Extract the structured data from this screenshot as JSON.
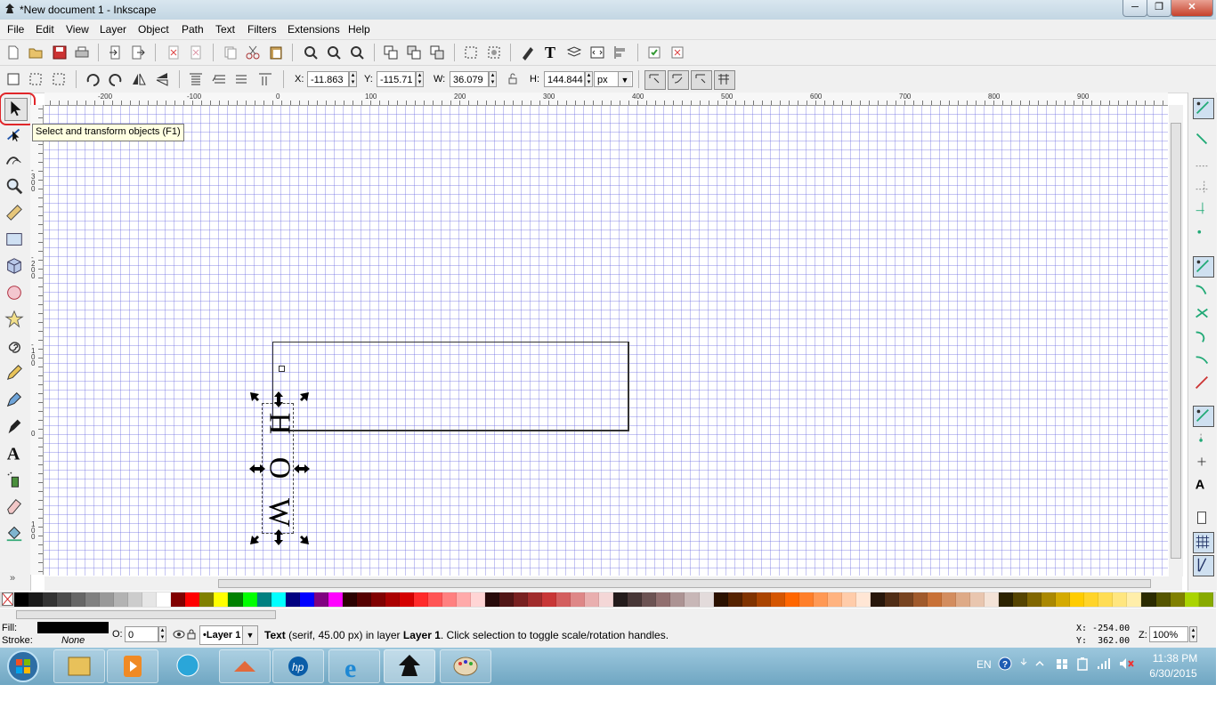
{
  "window": {
    "title": "*New document 1 - Inkscape",
    "minimize": "─",
    "maximize": "❐",
    "close": "✕"
  },
  "menu": [
    "File",
    "Edit",
    "View",
    "Layer",
    "Object",
    "Path",
    "Text",
    "Filters",
    "Extensions",
    "Help"
  ],
  "select_toolbar": {
    "x_label": "X:",
    "x_value": "-11.863",
    "y_label": "Y:",
    "y_value": "-115.71",
    "w_label": "W:",
    "w_value": "36.079",
    "h_label": "H:",
    "h_value": "144.844",
    "unit": "px"
  },
  "tooltip": "Select and transform objects (F1)",
  "ruler": {
    "h_ticks": [
      "-200",
      "-100",
      "0",
      "100",
      "200",
      "300",
      "400",
      "500",
      "600",
      "700",
      "800",
      "900"
    ],
    "v_ticks": [
      "-300",
      "-200",
      "-100",
      "0",
      "100"
    ]
  },
  "canvas": {
    "text_glyphs": [
      "H",
      "O",
      "W"
    ]
  },
  "palette_colors": [
    "#000000",
    "#1a1a1a",
    "#333333",
    "#4d4d4d",
    "#666666",
    "#808080",
    "#999999",
    "#b3b3b3",
    "#cccccc",
    "#e6e6e6",
    "#ffffff",
    "#800000",
    "#ff0000",
    "#808000",
    "#ffff00",
    "#008000",
    "#00ff00",
    "#008080",
    "#00ffff",
    "#000080",
    "#0000ff",
    "#800080",
    "#ff00ff",
    "#2b0000",
    "#550000",
    "#800000",
    "#aa0000",
    "#d40000",
    "#ff2a2a",
    "#ff5555",
    "#ff8080",
    "#ffaaaa",
    "#ffd5d5",
    "#280b0b",
    "#501616",
    "#782121",
    "#a02c2c",
    "#c83737",
    "#d35f5f",
    "#de8787",
    "#e9afaf",
    "#f4d7d7",
    "#241c1c",
    "#483737",
    "#6c5353",
    "#916f6f",
    "#ac9393",
    "#c8b7b7",
    "#e3dbdb",
    "#2b1100",
    "#552200",
    "#803300",
    "#aa4400",
    "#d45500",
    "#ff6600",
    "#ff7f2a",
    "#ff9955",
    "#ffb380",
    "#ffccaa",
    "#ffe6d5",
    "#28170b",
    "#502d16",
    "#784421",
    "#a05a2c",
    "#c87137",
    "#d38d5f",
    "#deaa87",
    "#e9c6af",
    "#f4e3d7",
    "#2b2200",
    "#554400",
    "#806600",
    "#aa8800",
    "#d4aa00",
    "#ffcc00",
    "#ffd42a",
    "#ffdd55",
    "#ffe680",
    "#ffeeaa",
    "#2b2b00",
    "#555500",
    "#808000",
    "#aad400",
    "#88aa00"
  ],
  "status": {
    "fill_label": "Fill:",
    "stroke_label": "Stroke:",
    "stroke_value": "None",
    "opacity_label": "O:",
    "opacity_value": "0",
    "layer": "•Layer 1",
    "message_bold": "Text",
    "message_mid": " (serif, 45.00 px) in layer ",
    "message_layer": "Layer 1",
    "message_end": ". Click selection to toggle scale/rotation handles.",
    "cursor_x": "X: -254.00",
    "cursor_y": "Y:  362.00",
    "zoom_label": "Z:",
    "zoom_value": "100%"
  },
  "taskbar": {
    "lang": "EN",
    "time": "11:38 PM",
    "date": "6/30/2015"
  }
}
